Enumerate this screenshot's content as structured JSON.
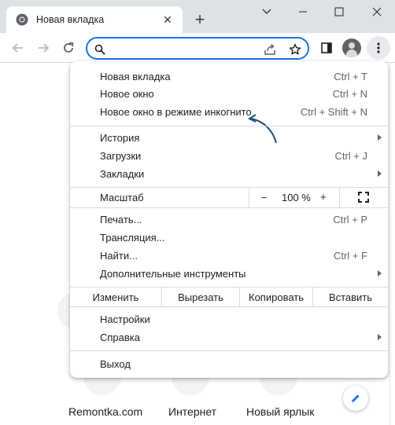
{
  "tab": {
    "title": "Новая вкладка",
    "close": "✕"
  },
  "titlebar": {
    "new_tab": "+"
  },
  "menu": {
    "group1": [
      {
        "label": "Новая вкладка",
        "shortcut": "Ctrl + T"
      },
      {
        "label": "Новое окно",
        "shortcut": "Ctrl + N"
      },
      {
        "label": "Новое окно в режиме инкогнито",
        "shortcut": "Ctrl + Shift + N"
      }
    ],
    "group2": [
      {
        "label": "История",
        "shortcut": ""
      },
      {
        "label": "Загрузки",
        "shortcut": "Ctrl + J"
      },
      {
        "label": "Закладки",
        "shortcut": ""
      }
    ],
    "zoom": {
      "label": "Масштаб",
      "minus": "–",
      "value": "100 %",
      "plus": "+"
    },
    "group3": [
      {
        "label": "Печать...",
        "shortcut": "Ctrl + P"
      },
      {
        "label": "Трансляция...",
        "shortcut": ""
      },
      {
        "label": "Найти...",
        "shortcut": "Ctrl + F"
      },
      {
        "label": "Дополнительные инструменты",
        "shortcut": ""
      }
    ],
    "edit": {
      "label": "Изменить",
      "cut": "Вырезать",
      "copy": "Копировать",
      "paste": "Вставить"
    },
    "group4": [
      {
        "label": "Настройки"
      },
      {
        "label": "Справка"
      }
    ],
    "exit": "Выход"
  },
  "shortcuts": [
    {
      "label": "Remontka.com"
    },
    {
      "label": "Интернет"
    },
    {
      "label": "Новый ярлык"
    }
  ],
  "colors": {
    "accent": "#1a73e8",
    "annotation_arrow": "#1e4f7a"
  }
}
